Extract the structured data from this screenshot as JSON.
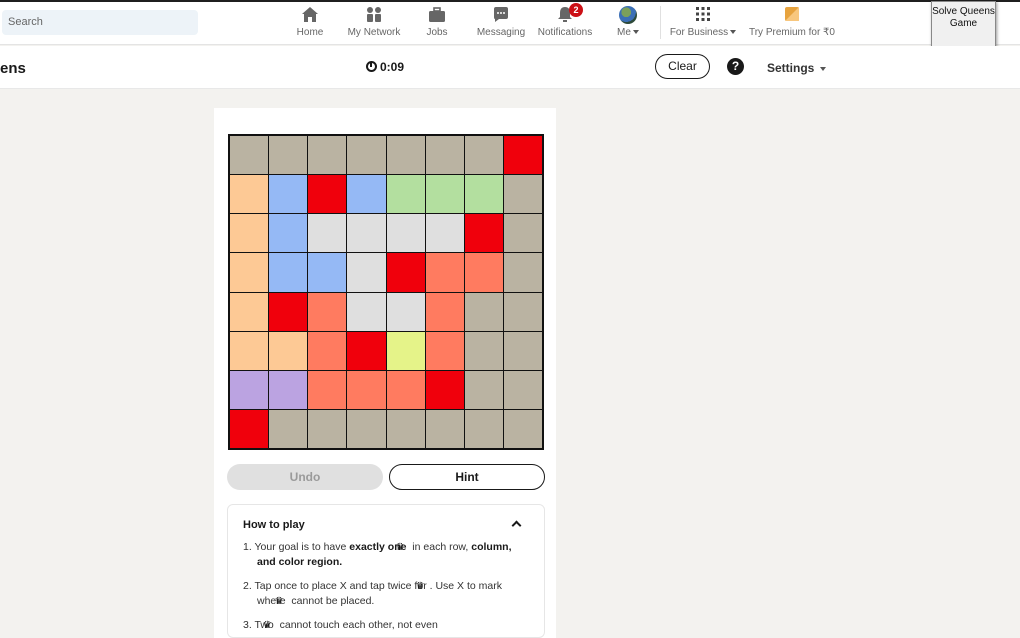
{
  "nav": {
    "search_placeholder": "Search",
    "items": [
      {
        "label": "Home",
        "icon": "home-icon"
      },
      {
        "label": "My Network",
        "icon": "network-icon"
      },
      {
        "label": "Jobs",
        "icon": "briefcase-icon"
      },
      {
        "label": "Messaging",
        "icon": "message-icon"
      },
      {
        "label": "Notifications",
        "icon": "bell-icon",
        "badge": "2"
      },
      {
        "label": "Me",
        "icon": "avatar"
      },
      {
        "label": "For Business",
        "icon": "grid-icon"
      },
      {
        "label": "Try Premium for ₹0",
        "icon": "premium-icon"
      }
    ]
  },
  "extension": {
    "label": "Solve Queens Game"
  },
  "game": {
    "title": "ens",
    "timer": "0:09",
    "clear_label": "Clear",
    "help_label": "?",
    "settings_label": "Settings",
    "undo_label": "Undo",
    "hint_label": "Hint"
  },
  "board": {
    "size": 8,
    "palette": {
      "T": "#bab3a2",
      "R": "#f0000c",
      "O": "#fdc995",
      "B": "#95b9f5",
      "G": "#b3df9f",
      "W": "#dfdfdf",
      "S": "#ff7b60",
      "Y": "#e5f389",
      "P": "#bba3e1"
    },
    "rows": [
      "TTTTTTTR",
      "OBRBGGGT",
      "OBWWWWRT",
      "OBBWRSST",
      "ORSWWSTT",
      "OOSRYSTT",
      "PPSSSRTT",
      "RTTTTTTT"
    ]
  },
  "howto": {
    "title": "How to play",
    "rules": [
      {
        "n": "1.",
        "a": "Your goal is to have ",
        "b": "exactly one",
        "c": " in each row, ",
        "d": "column, and color region.",
        "e": ""
      },
      {
        "n": "2.",
        "a": "Tap once to place X and tap twice for ",
        "b": "",
        "c": ". Use X to mark where ",
        "d": "",
        "e": " cannot be placed."
      },
      {
        "n": "3.",
        "a": "Two ",
        "b": "",
        "c": " cannot touch each other, not even",
        "d": "",
        "e": ""
      }
    ]
  }
}
